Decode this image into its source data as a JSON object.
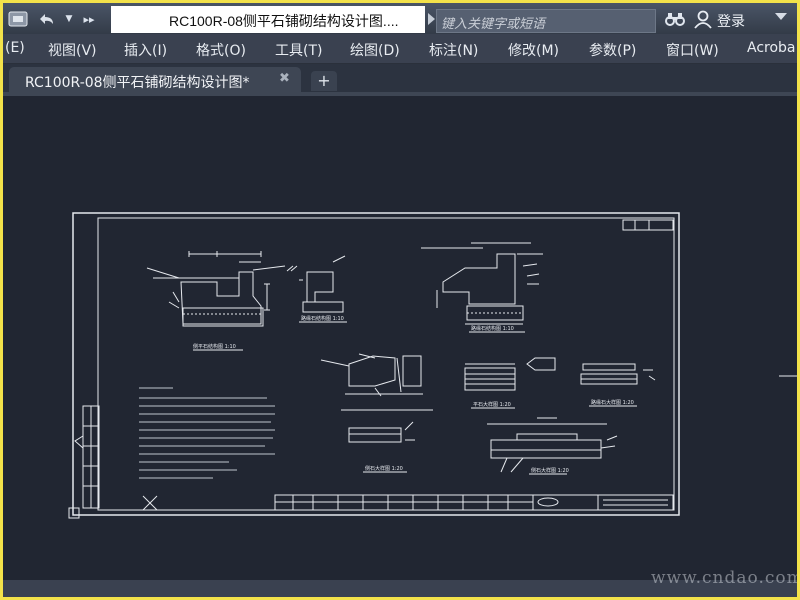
{
  "window": {
    "title": "RC100R-08侧平石铺砌结构设计图....",
    "search_placeholder": "键入关键字或短语",
    "login_label": "登录"
  },
  "quick_access": [
    "open-icon",
    "undo-icon",
    "dropdown-icon",
    "more-icon"
  ],
  "menu": [
    {
      "label": "(E)"
    },
    {
      "label": "视图(V)"
    },
    {
      "label": "插入(I)"
    },
    {
      "label": "格式(O)"
    },
    {
      "label": "工具(T)"
    },
    {
      "label": "绘图(D)"
    },
    {
      "label": "标注(N)"
    },
    {
      "label": "修改(M)"
    },
    {
      "label": "参数(P)"
    },
    {
      "label": "窗口(W)"
    },
    {
      "label": "Acroba"
    }
  ],
  "tabs": [
    {
      "label": "RC100R-08侧平石铺砌结构设计图*",
      "active": true
    }
  ],
  "drawing": {
    "detail_titles": [
      "侧平石结构图 1:10",
      "路缘石结构图 1:10",
      "路缘石结构图 1:10",
      "平石大样图 1:20",
      "路缘石大样图 1:20",
      "侧石大样图 1:20",
      "侧石大样图 1:20"
    ]
  },
  "watermark": "www.cndao.com",
  "colors": {
    "background_border": "#f3e24a",
    "canvas": "#212632",
    "drawing_lines": "#e6e9ee"
  }
}
